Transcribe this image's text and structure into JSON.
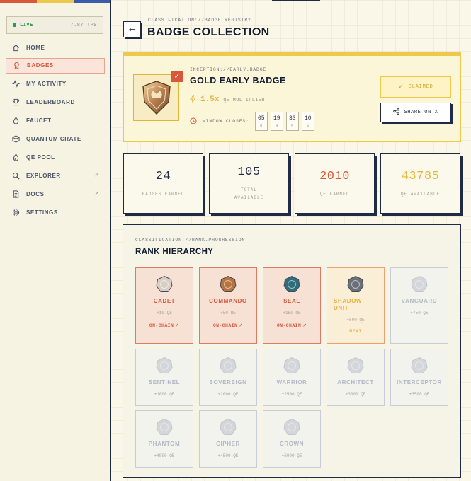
{
  "status": {
    "live_label": "LIVE",
    "tps": "7.87 TPS"
  },
  "nav": [
    {
      "label": "HOME",
      "icon": "home-icon",
      "external": false
    },
    {
      "label": "BADGES",
      "icon": "badge-icon",
      "external": false,
      "active": true
    },
    {
      "label": "MY ACTIVITY",
      "icon": "activity-icon",
      "external": false
    },
    {
      "label": "LEADERBOARD",
      "icon": "trophy-icon",
      "external": false
    },
    {
      "label": "FAUCET",
      "icon": "droplet-icon",
      "external": false
    },
    {
      "label": "QUANTUM CRATE",
      "icon": "box-icon",
      "external": false
    },
    {
      "label": "QE POOL",
      "icon": "pool-icon",
      "external": false
    },
    {
      "label": "EXPLORER",
      "icon": "search-icon",
      "external": true,
      "ext_glyph": "↗"
    },
    {
      "label": "DOCS",
      "icon": "document-icon",
      "external": true,
      "ext_glyph": "↗"
    },
    {
      "label": "SETTINGS",
      "icon": "gear-icon",
      "external": false
    }
  ],
  "header": {
    "classification": "CLASSIFICATION://BADGE.REGISTRY",
    "title": "BADGE COLLECTION",
    "back_glyph": "←"
  },
  "featured": {
    "inception": "INCEPTION://EARLY.BADGE",
    "name": "GOLD EARLY BADGE",
    "multiplier": "1.5x",
    "multiplier_label": "QE MULTIPLIER",
    "window_label": "WINDOW CLOSES:",
    "countdown": [
      {
        "value": "05",
        "unit": "D"
      },
      {
        "value": "19",
        "unit": "H"
      },
      {
        "value": "33",
        "unit": "M"
      },
      {
        "value": "10",
        "unit": "S"
      }
    ],
    "claimed_label": "CLAIMED",
    "share_label": "SHARE ON X"
  },
  "stats": [
    {
      "value": "24",
      "label": "BADGES EARNED",
      "color": "#1f2a44"
    },
    {
      "value": "105",
      "label": "TOTAL AVAILABLE",
      "color": "#1f2a44"
    },
    {
      "value": "2010",
      "label": "QE EARNED",
      "color": "#d9573a"
    },
    {
      "value": "43785",
      "label": "QE AVAILABLE",
      "color": "#e8b730"
    }
  ],
  "ranks_section": {
    "classification": "CLASSIFICATION://RANK.PROGRESSION",
    "title": "RANK HIERARCHY"
  },
  "ranks": [
    {
      "name": "CADET",
      "qe": "+10 QE",
      "state": "earned",
      "chain": "ON-CHAIN"
    },
    {
      "name": "COMMANDO",
      "qe": "+50 QE",
      "state": "earned",
      "chain": "ON-CHAIN"
    },
    {
      "name": "SEAL",
      "qe": "+150 QE",
      "state": "earned",
      "chain": "ON-CHAIN"
    },
    {
      "name": "SHADOW UNIT",
      "qe": "+500 QE",
      "state": "next",
      "next_label": "NEXT"
    },
    {
      "name": "VANGUARD",
      "qe": "+750 QE",
      "state": "locked"
    },
    {
      "name": "SENTINEL",
      "qe": "+1000 QE",
      "state": "locked"
    },
    {
      "name": "SOVEREIGN",
      "qe": "+2000 QE",
      "state": "locked"
    },
    {
      "name": "WARRIOR",
      "qe": "+2500 QE",
      "state": "locked"
    },
    {
      "name": "ARCHITECT",
      "qe": "+3000 QE",
      "state": "locked"
    },
    {
      "name": "INTERCEPTOR",
      "qe": "+3500 QE",
      "state": "locked"
    },
    {
      "name": "PHANTOM",
      "qe": "+4000 QE",
      "state": "locked"
    },
    {
      "name": "CIPHER",
      "qe": "+4500 QE",
      "state": "locked"
    },
    {
      "name": "CROWN",
      "qe": "+5000 QE",
      "state": "locked"
    }
  ],
  "colors": {
    "accent_red": "#d9573a",
    "accent_yellow": "#ecc94b",
    "accent_blue": "#3b5aa8",
    "navy": "#1f2a44",
    "live_green": "#2e9a4c"
  }
}
